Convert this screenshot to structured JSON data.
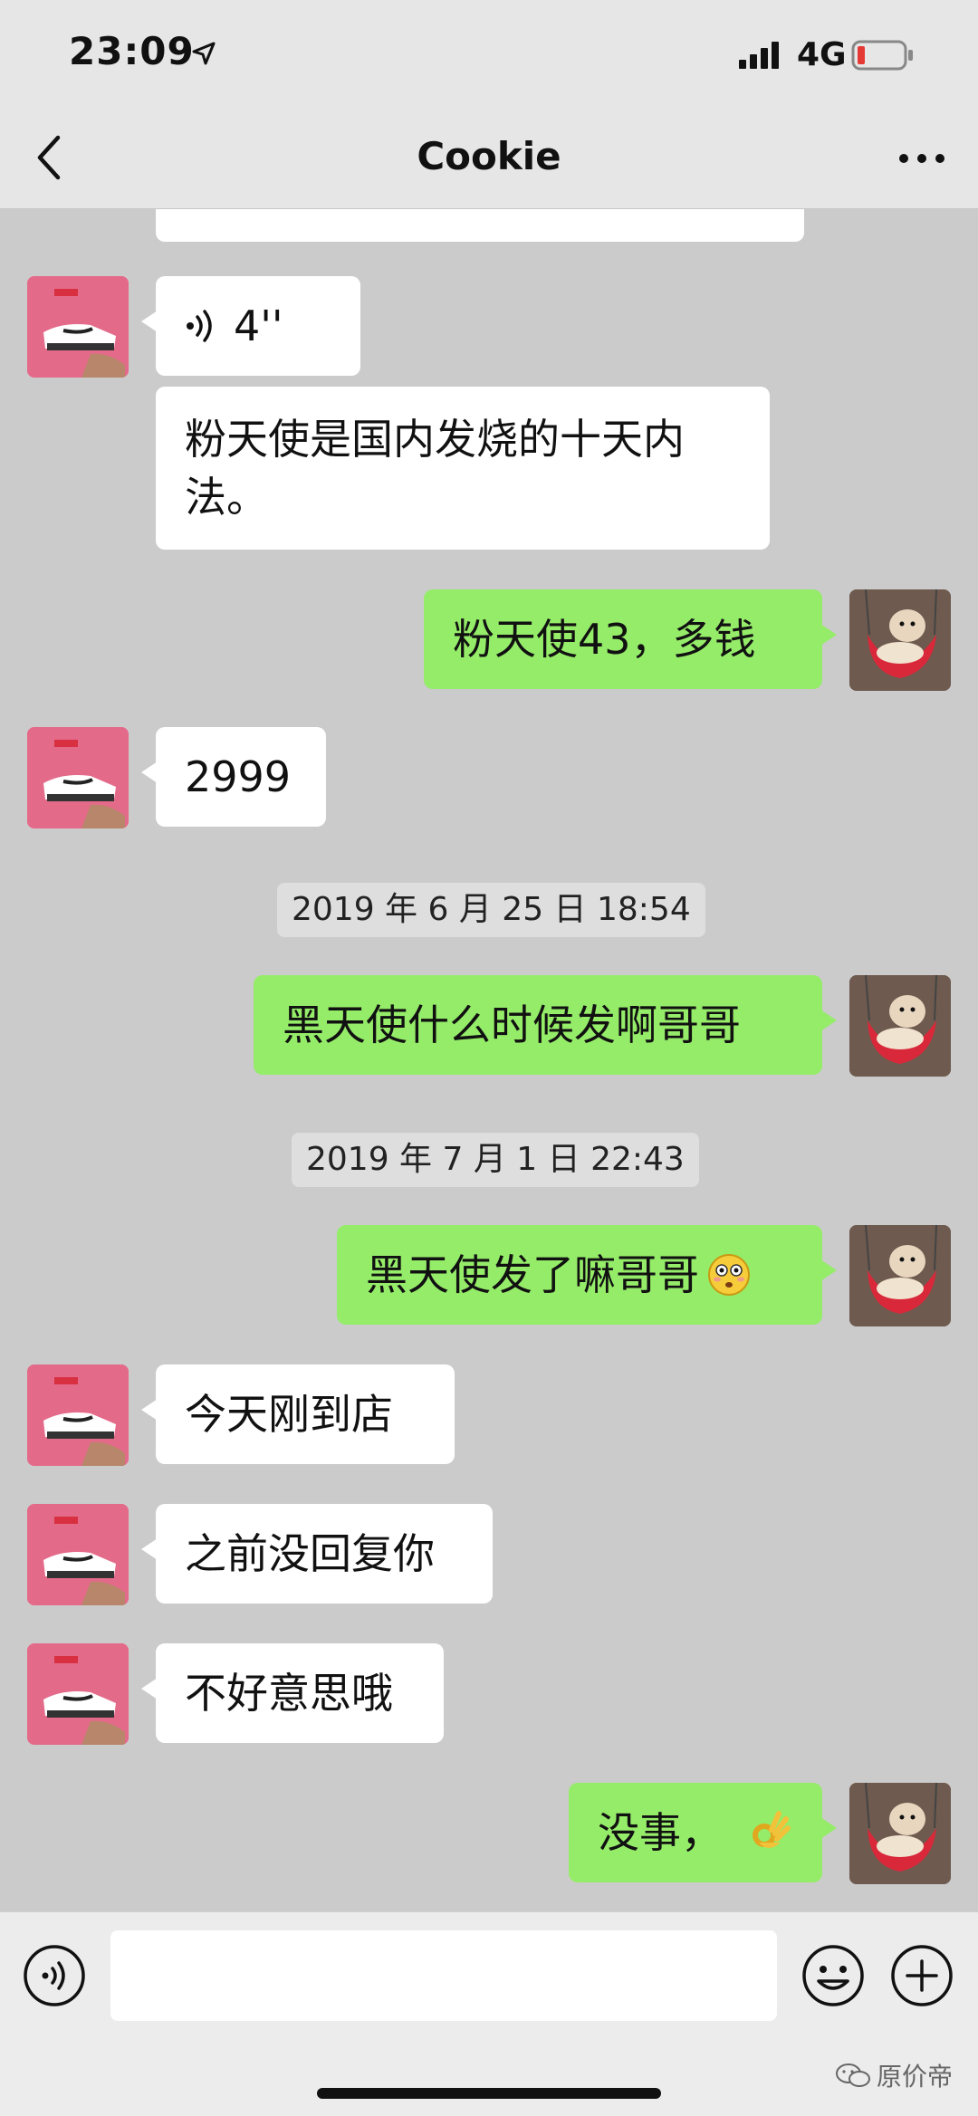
{
  "status_bar": {
    "time": "23:09",
    "network": "4G"
  },
  "nav": {
    "title": "Cookie"
  },
  "messages": [
    {
      "id": "m0",
      "from": "contact",
      "type": "text",
      "text": ""
    },
    {
      "id": "m1",
      "from": "contact",
      "type": "voice",
      "duration": "4''"
    },
    {
      "id": "m2",
      "from": "contact",
      "type": "text",
      "text": "粉天使是国内发烧的十天内法。"
    },
    {
      "id": "m3",
      "from": "me",
      "type": "text",
      "text": "粉天使43，多钱"
    },
    {
      "id": "m4",
      "from": "contact",
      "type": "text",
      "text": "2999"
    },
    {
      "id": "t1",
      "type": "timestamp",
      "text": "2019 年 6 月 25 日 18:54"
    },
    {
      "id": "m5",
      "from": "me",
      "type": "text",
      "text": "黑天使什么时候发啊哥哥"
    },
    {
      "id": "t2",
      "type": "timestamp",
      "text": "2019 年 7 月 1 日 22:43"
    },
    {
      "id": "m6",
      "from": "me",
      "type": "text",
      "text": "黑天使发了嘛哥哥",
      "emoji": "flushed-face"
    },
    {
      "id": "m7",
      "from": "contact",
      "type": "text",
      "text": "今天刚到店"
    },
    {
      "id": "m8",
      "from": "contact",
      "type": "text",
      "text": "之前没回复你"
    },
    {
      "id": "m9",
      "from": "contact",
      "type": "text",
      "text": "不好意思哦"
    },
    {
      "id": "m10",
      "from": "me",
      "type": "text",
      "text": "没事，",
      "emoji": "ok-hand"
    }
  ],
  "m2_lines": [
    "粉天使是国内发烧的十天内",
    "法。"
  ],
  "input_bar": {
    "placeholder": ""
  },
  "watermark": {
    "text": "原价帝"
  },
  "colors": {
    "outgoing_bubble": "#95ec69",
    "incoming_bubble": "#ffffff",
    "chat_background": "#cbcbcb"
  }
}
